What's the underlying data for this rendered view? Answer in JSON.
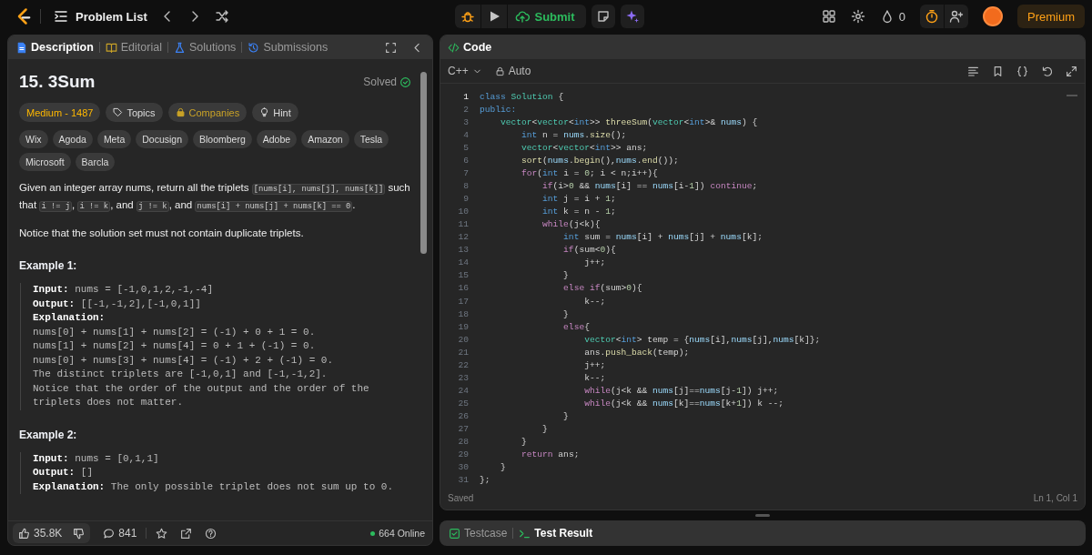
{
  "topbar": {
    "nav_title": "Problem List",
    "submit": "Submit",
    "streak": "0",
    "premium": "Premium"
  },
  "description_panel": {
    "tabs": [
      {
        "label": "Description",
        "kind": "description",
        "selected": true
      },
      {
        "label": "Editorial",
        "kind": "editorial",
        "selected": false
      },
      {
        "label": "Solutions",
        "kind": "solutions",
        "selected": false
      },
      {
        "label": "Submissions",
        "kind": "submissions",
        "selected": false
      }
    ],
    "problem": {
      "title": "15. 3Sum",
      "status": "Solved",
      "tags": [
        {
          "kind": "difficulty",
          "label": "Medium - 1487"
        },
        {
          "kind": "topics",
          "label": "Topics"
        },
        {
          "kind": "companies",
          "label": "Companies"
        },
        {
          "kind": "hint",
          "label": "Hint"
        }
      ],
      "companies": [
        "Wix",
        "Agoda",
        "Meta",
        "Docusign",
        "Bloomberg",
        "Adobe",
        "Amazon",
        "Tesla",
        "Microsoft",
        "Barcla"
      ],
      "statement": [
        {
          "kind": "text",
          "text": "Given an integer array nums, return all the triplets "
        },
        {
          "kind": "code",
          "text": "[nums[i], nums[j], nums[k]]"
        },
        {
          "kind": "text",
          "text": " such that "
        },
        {
          "kind": "code",
          "text": "i != j"
        },
        {
          "kind": "text",
          "text": ", "
        },
        {
          "kind": "code",
          "text": "i != k"
        },
        {
          "kind": "text",
          "text": ", and "
        },
        {
          "kind": "code",
          "text": "j != k"
        },
        {
          "kind": "text",
          "text": ", and "
        },
        {
          "kind": "code",
          "text": "nums[i] + nums[j] + nums[k] == 0"
        },
        {
          "kind": "text",
          "text": "."
        }
      ],
      "note": "Notice that the solution set must not contain duplicate triplets.",
      "examples": [
        {
          "title": "Example 1:",
          "lines": [
            "**Input:** nums = [-1,0,1,2,-1,-4]",
            "**Output:** [[-1,-1,2],[-1,0,1]]",
            "**Explanation:**",
            "nums[0] + nums[1] + nums[2] = (-1) + 0 + 1 = 0.",
            "nums[1] + nums[2] + nums[4] = 0 + 1 + (-1) = 0.",
            "nums[0] + nums[3] + nums[4] = (-1) + 2 + (-1) = 0.",
            "The distinct triplets are [-1,0,1] and [-1,-1,2].",
            "Notice that the order of the output and the order of the triplets does not matter."
          ]
        },
        {
          "title": "Example 2:",
          "lines": [
            "**Input:** nums = [0,1,1]",
            "**Output:** []",
            "**Explanation:** The only possible triplet does not sum up to 0."
          ]
        }
      ]
    },
    "footer": {
      "likes": "35.8K",
      "comments": "841",
      "online": "664 Online"
    }
  },
  "code_panel": {
    "title": "Code",
    "language": "C++",
    "mode": "Auto",
    "lines": [
      {
        "number": "1",
        "active": true,
        "tokens": [
          {
            "kind": "keyword",
            "text": "class"
          },
          {
            "kind": "type",
            "text": " Solution"
          },
          {
            "kind": "plain",
            "text": " {"
          }
        ]
      },
      {
        "number": "2",
        "active": false,
        "tokens": [
          {
            "kind": "keyword",
            "text": "public:"
          }
        ]
      },
      {
        "number": "3",
        "active": false,
        "tokens": [
          {
            "kind": "type",
            "text": "    vector"
          },
          {
            "kind": "plain",
            "text": "<"
          },
          {
            "kind": "type",
            "text": "vector"
          },
          {
            "kind": "plain",
            "text": "<"
          },
          {
            "kind": "keyword",
            "text": "int"
          },
          {
            "kind": "plain",
            "text": ">> "
          },
          {
            "kind": "function",
            "text": "threeSum"
          },
          {
            "kind": "plain",
            "text": "("
          },
          {
            "kind": "type",
            "text": "vector"
          },
          {
            "kind": "plain",
            "text": "<"
          },
          {
            "kind": "keyword",
            "text": "int"
          },
          {
            "kind": "plain",
            "text": ">& "
          },
          {
            "kind": "variable",
            "text": "nums"
          },
          {
            "kind": "plain",
            "text": ") {"
          }
        ]
      },
      {
        "number": "4",
        "active": false,
        "tokens": [
          {
            "kind": "keyword",
            "text": "        int"
          },
          {
            "kind": "plain",
            "text": " n = "
          },
          {
            "kind": "variable",
            "text": "nums"
          },
          {
            "kind": "plain",
            "text": "."
          },
          {
            "kind": "function",
            "text": "size"
          },
          {
            "kind": "plain",
            "text": "();"
          }
        ]
      },
      {
        "number": "5",
        "active": false,
        "tokens": [
          {
            "kind": "type",
            "text": "        vector"
          },
          {
            "kind": "plain",
            "text": "<"
          },
          {
            "kind": "type",
            "text": "vector"
          },
          {
            "kind": "plain",
            "text": "<"
          },
          {
            "kind": "keyword",
            "text": "int"
          },
          {
            "kind": "plain",
            "text": ">> ans;"
          }
        ]
      },
      {
        "number": "6",
        "active": false,
        "tokens": [
          {
            "kind": "function",
            "text": "        sort"
          },
          {
            "kind": "plain",
            "text": "("
          },
          {
            "kind": "variable",
            "text": "nums"
          },
          {
            "kind": "plain",
            "text": "."
          },
          {
            "kind": "function",
            "text": "begin"
          },
          {
            "kind": "plain",
            "text": "(),"
          },
          {
            "kind": "variable",
            "text": "nums"
          },
          {
            "kind": "plain",
            "text": "."
          },
          {
            "kind": "function",
            "text": "end"
          },
          {
            "kind": "plain",
            "text": "());"
          }
        ]
      },
      {
        "number": "7",
        "active": false,
        "tokens": [
          {
            "kind": "control",
            "text": "        for"
          },
          {
            "kind": "plain",
            "text": "("
          },
          {
            "kind": "keyword",
            "text": "int"
          },
          {
            "kind": "plain",
            "text": " i = "
          },
          {
            "kind": "number",
            "text": "0"
          },
          {
            "kind": "plain",
            "text": "; i < n;i++){"
          }
        ]
      },
      {
        "number": "8",
        "active": false,
        "tokens": [
          {
            "kind": "control",
            "text": "            if"
          },
          {
            "kind": "plain",
            "text": "(i>"
          },
          {
            "kind": "number",
            "text": "0"
          },
          {
            "kind": "plain",
            "text": " && "
          },
          {
            "kind": "variable",
            "text": "nums"
          },
          {
            "kind": "plain",
            "text": "[i] == "
          },
          {
            "kind": "variable",
            "text": "nums"
          },
          {
            "kind": "plain",
            "text": "[i-"
          },
          {
            "kind": "number",
            "text": "1"
          },
          {
            "kind": "plain",
            "text": "]) "
          },
          {
            "kind": "control",
            "text": "continue"
          },
          {
            "kind": "plain",
            "text": ";"
          }
        ]
      },
      {
        "number": "9",
        "active": false,
        "tokens": [
          {
            "kind": "keyword",
            "text": "            int"
          },
          {
            "kind": "plain",
            "text": " j = i + "
          },
          {
            "kind": "number",
            "text": "1"
          },
          {
            "kind": "plain",
            "text": ";"
          }
        ]
      },
      {
        "number": "10",
        "active": false,
        "tokens": [
          {
            "kind": "keyword",
            "text": "            int"
          },
          {
            "kind": "plain",
            "text": " k = n - "
          },
          {
            "kind": "number",
            "text": "1"
          },
          {
            "kind": "plain",
            "text": ";"
          }
        ]
      },
      {
        "number": "11",
        "active": false,
        "tokens": [
          {
            "kind": "control",
            "text": "            while"
          },
          {
            "kind": "plain",
            "text": "(j<k){"
          }
        ]
      },
      {
        "number": "12",
        "active": false,
        "tokens": [
          {
            "kind": "keyword",
            "text": "                int"
          },
          {
            "kind": "plain",
            "text": " sum = "
          },
          {
            "kind": "variable",
            "text": "nums"
          },
          {
            "kind": "plain",
            "text": "[i] + "
          },
          {
            "kind": "variable",
            "text": "nums"
          },
          {
            "kind": "plain",
            "text": "[j] + "
          },
          {
            "kind": "variable",
            "text": "nums"
          },
          {
            "kind": "plain",
            "text": "[k];"
          }
        ]
      },
      {
        "number": "13",
        "active": false,
        "tokens": [
          {
            "kind": "control",
            "text": "                if"
          },
          {
            "kind": "plain",
            "text": "(sum<"
          },
          {
            "kind": "number",
            "text": "0"
          },
          {
            "kind": "plain",
            "text": "){"
          }
        ]
      },
      {
        "number": "14",
        "active": false,
        "tokens": [
          {
            "kind": "plain",
            "text": "                    j++;"
          }
        ]
      },
      {
        "number": "15",
        "active": false,
        "tokens": [
          {
            "kind": "plain",
            "text": "                }"
          }
        ]
      },
      {
        "number": "16",
        "active": false,
        "tokens": [
          {
            "kind": "control",
            "text": "                else if"
          },
          {
            "kind": "plain",
            "text": "(sum>"
          },
          {
            "kind": "number",
            "text": "0"
          },
          {
            "kind": "plain",
            "text": "){"
          }
        ]
      },
      {
        "number": "17",
        "active": false,
        "tokens": [
          {
            "kind": "plain",
            "text": "                    k--;"
          }
        ]
      },
      {
        "number": "18",
        "active": false,
        "tokens": [
          {
            "kind": "plain",
            "text": "                }"
          }
        ]
      },
      {
        "number": "19",
        "active": false,
        "tokens": [
          {
            "kind": "control",
            "text": "                else"
          },
          {
            "kind": "plain",
            "text": "{"
          }
        ]
      },
      {
        "number": "20",
        "active": false,
        "tokens": [
          {
            "kind": "type",
            "text": "                    vector"
          },
          {
            "kind": "plain",
            "text": "<"
          },
          {
            "kind": "keyword",
            "text": "int"
          },
          {
            "kind": "plain",
            "text": "> temp = {"
          },
          {
            "kind": "variable",
            "text": "nums"
          },
          {
            "kind": "plain",
            "text": "[i],"
          },
          {
            "kind": "variable",
            "text": "nums"
          },
          {
            "kind": "plain",
            "text": "[j],"
          },
          {
            "kind": "variable",
            "text": "nums"
          },
          {
            "kind": "plain",
            "text": "[k]};"
          }
        ]
      },
      {
        "number": "21",
        "active": false,
        "tokens": [
          {
            "kind": "plain",
            "text": "                    ans."
          },
          {
            "kind": "function",
            "text": "push_back"
          },
          {
            "kind": "plain",
            "text": "(temp);"
          }
        ]
      },
      {
        "number": "22",
        "active": false,
        "tokens": [
          {
            "kind": "plain",
            "text": "                    j++;"
          }
        ]
      },
      {
        "number": "23",
        "active": false,
        "tokens": [
          {
            "kind": "plain",
            "text": "                    k--;"
          }
        ]
      },
      {
        "number": "24",
        "active": false,
        "tokens": [
          {
            "kind": "control",
            "text": "                    while"
          },
          {
            "kind": "plain",
            "text": "(j<k && "
          },
          {
            "kind": "variable",
            "text": "nums"
          },
          {
            "kind": "plain",
            "text": "[j]=="
          },
          {
            "kind": "variable",
            "text": "nums"
          },
          {
            "kind": "plain",
            "text": "[j-"
          },
          {
            "kind": "number",
            "text": "1"
          },
          {
            "kind": "plain",
            "text": "]) j++;"
          }
        ]
      },
      {
        "number": "25",
        "active": false,
        "tokens": [
          {
            "kind": "control",
            "text": "                    while"
          },
          {
            "kind": "plain",
            "text": "(j<k && "
          },
          {
            "kind": "variable",
            "text": "nums"
          },
          {
            "kind": "plain",
            "text": "[k]=="
          },
          {
            "kind": "variable",
            "text": "nums"
          },
          {
            "kind": "plain",
            "text": "[k+"
          },
          {
            "kind": "number",
            "text": "1"
          },
          {
            "kind": "plain",
            "text": "]) k --;"
          }
        ]
      },
      {
        "number": "26",
        "active": false,
        "tokens": [
          {
            "kind": "plain",
            "text": "                }"
          }
        ]
      },
      {
        "number": "27",
        "active": false,
        "tokens": [
          {
            "kind": "plain",
            "text": "            }"
          }
        ]
      },
      {
        "number": "28",
        "active": false,
        "tokens": [
          {
            "kind": "plain",
            "text": "        }"
          }
        ]
      },
      {
        "number": "29",
        "active": false,
        "tokens": [
          {
            "kind": "control",
            "text": "        return"
          },
          {
            "kind": "plain",
            "text": " ans;"
          }
        ]
      },
      {
        "number": "30",
        "active": false,
        "tokens": [
          {
            "kind": "plain",
            "text": "    }"
          }
        ]
      },
      {
        "number": "31",
        "active": false,
        "tokens": [
          {
            "kind": "plain",
            "text": "};"
          }
        ]
      }
    ],
    "status": "Saved",
    "cursor": "Ln 1, Col 1"
  },
  "bottom_panel": {
    "tabs": [
      {
        "label": "Testcase",
        "kind": "testcase",
        "selected": false
      },
      {
        "label": "Test Result",
        "kind": "result",
        "selected": true
      }
    ]
  }
}
